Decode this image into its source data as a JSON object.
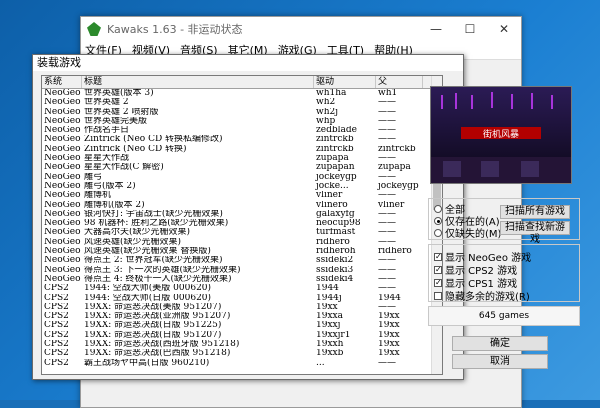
{
  "main_window": {
    "title": "Kawaks 1.63 - 非运动状态",
    "menu": [
      "文件(F)",
      "视频(V)",
      "音频(S)",
      "其它(M)",
      "游戏(G)",
      "工具(T)",
      "帮助(H)"
    ],
    "buttons": {
      "minimize": "—",
      "maximize": "☐",
      "close": "✕"
    }
  },
  "dialog": {
    "title": "装载游戏",
    "columns": [
      "系统",
      "标题",
      "驱动",
      "父"
    ],
    "rows": [
      [
        "NeoGeo",
        "世界英雄(版本 3)",
        "wh1ha",
        "wh1"
      ],
      [
        "NeoGeo",
        "世界英雄 2",
        "wh2",
        "——"
      ],
      [
        "NeoGeo",
        "世界英雄 2 喷射版",
        "wh2j",
        "——"
      ],
      [
        "NeoGeo",
        "世界英雄完美版",
        "whp",
        "——"
      ],
      [
        "NeoGeo",
        "作战名手日",
        "zedblade",
        "——"
      ],
      [
        "NeoGeo",
        "Zintrick (Neo CD 转换私编修改)",
        "zintrckb",
        "——"
      ],
      [
        "NeoGeo",
        "Zintrick (Neo CD 转换)",
        "zintrckb",
        "zintrckb"
      ],
      [
        "NeoGeo",
        "星星大作战",
        "zupapa",
        "——"
      ],
      [
        "NeoGeo",
        "星星大作战(C 解密)",
        "zupapan",
        "zupapa"
      ],
      [
        "NeoGeo",
        "雕弓",
        "jockeygp",
        "——"
      ],
      [
        "NeoGeo",
        "雕弓(版本 2)",
        "jocke...",
        "jockeygp"
      ],
      [
        "NeoGeo",
        "雕博机",
        "vliner",
        "——"
      ],
      [
        "NeoGeo",
        "雕博机(版本 2)",
        "vlinero",
        "vliner"
      ],
      [
        "NeoGeo",
        "银河快打: 宇宙战士(缺少光栅效果)",
        "galaxyfg",
        "——"
      ],
      [
        "NeoGeo",
        "98 机器杯: 胜利之路(缺少光栅效果)",
        "neocup98",
        "——"
      ],
      [
        "NeoGeo",
        "大器高尔夫(缺少光栅效果)",
        "turfmast",
        "——"
      ],
      [
        "NeoGeo",
        "风速英雄(缺少光栅效果)",
        "ridhero",
        "——"
      ],
      [
        "NeoGeo",
        "风速英雄(缺少光栅效果 替换版)",
        "ridheroh",
        "ridhero"
      ],
      [
        "NeoGeo",
        "得点王 2: 世界冠军(缺少光栅效果)",
        "ssideki2",
        "——"
      ],
      [
        "NeoGeo",
        "得点王 3: 下一次的英雄(缺少光栅效果)",
        "ssideki3",
        "——"
      ],
      [
        "NeoGeo",
        "得点王 4: 终极十一人(缺少光栅效果)",
        "ssideki4",
        "——"
      ],
      [
        "CPS2",
        "1944: 空战大师(美版 000620)",
        "1944",
        "——"
      ],
      [
        "CPS2",
        "1944: 空战大师(日版 000620)",
        "1944j",
        "1944"
      ],
      [
        "CPS2",
        "19XX: 命运恶决战(美版 951207)",
        "19xx",
        "——"
      ],
      [
        "CPS2",
        "19XX: 命运恶决战(亚洲版 951207)",
        "19xxa",
        "19xx"
      ],
      [
        "CPS2",
        "19XX: 命运恶决战(日版 951225)",
        "19xxj",
        "19xx"
      ],
      [
        "CPS2",
        "19XX: 命运恶决战(日版 951207)",
        "19xxjr1",
        "19xx"
      ],
      [
        "CPS2",
        "19XX: 命运恶决战(西班牙版 951218)",
        "19xxh",
        "19xx"
      ],
      [
        "CPS2",
        "19XX: 命运恶决战(巴西版 951218)",
        "19xxb",
        "19xx"
      ],
      [
        "CPS2",
        "霸王战场ヤ中高(日版 960210)",
        "...",
        "——"
      ]
    ],
    "preview_text": "街机风暴",
    "filter_options": [
      "全部",
      "仅存在的(A)",
      "仅缺失的(M)"
    ],
    "filter_selected": 1,
    "scan_all_button": "扫描所有游戏",
    "rescan_button": "扫描查找新游戏",
    "checkboxes": [
      {
        "label": "显示 NeoGeo 游戏",
        "checked": true
      },
      {
        "label": "显示 CPS2 游戏",
        "checked": true
      },
      {
        "label": "显示 CPS1 游戏",
        "checked": true
      },
      {
        "label": "隐藏多余的游戏(R)",
        "checked": false
      }
    ],
    "games_count": "645 games",
    "ok_button": "确定",
    "cancel_button": "取消"
  }
}
